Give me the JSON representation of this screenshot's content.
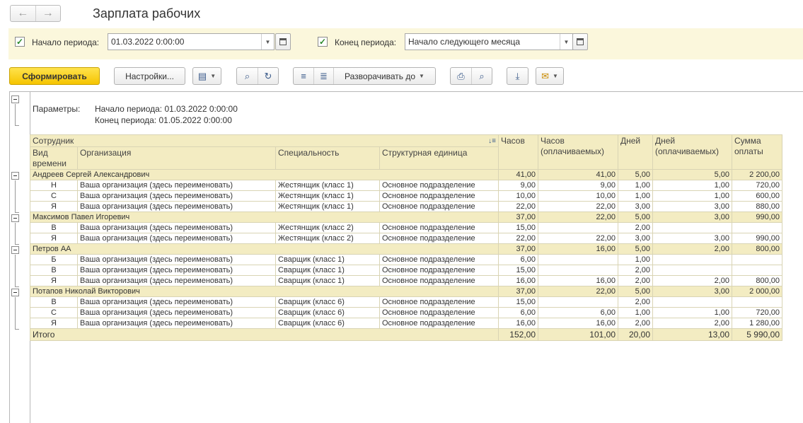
{
  "window": {
    "title": "Зарплата рабочих"
  },
  "nav": {
    "back": "←",
    "forward": "→"
  },
  "period": {
    "start_label": "Начало периода:",
    "start_value": "01.03.2022  0:00:00",
    "end_label": "Конец периода:",
    "end_value": "Начало следующего месяца",
    "start_checked": "✓",
    "end_checked": "✓"
  },
  "toolbar": {
    "generate": "Сформировать",
    "settings": "Настройки...",
    "expand": "Разворачивать до"
  },
  "params": {
    "label": "Параметры:",
    "line1": "Начало периода: 01.03.2022 0:00:00",
    "line2": "Конец периода: 01.05.2022 0:00:00"
  },
  "columns": {
    "employee": "Сотрудник",
    "time_type": "Вид времени",
    "org": "Организация",
    "spec": "Специальность",
    "unit": "Структурная единица",
    "hours": "Часов",
    "hours_paid": "Часов (оплачиваемых)",
    "days": "Дней",
    "days_paid": "Дней (оплачиваемых)",
    "sum": "Сумма оплаты"
  },
  "groups": [
    {
      "name": "Андреев Сергей Александрович",
      "hours": "41,00",
      "hours_paid": "41,00",
      "days": "5,00",
      "days_paid": "5,00",
      "sum": "2 200,00",
      "rows": [
        {
          "type": "Н",
          "org": "Ваша организация (здесь переименовать)",
          "spec": "Жестянщик (класс 1)",
          "unit": "Основное подразделение",
          "hours": "9,00",
          "hours_paid": "9,00",
          "days": "1,00",
          "days_paid": "1,00",
          "sum": "720,00"
        },
        {
          "type": "С",
          "org": "Ваша организация (здесь переименовать)",
          "spec": "Жестянщик (класс 1)",
          "unit": "Основное подразделение",
          "hours": "10,00",
          "hours_paid": "10,00",
          "days": "1,00",
          "days_paid": "1,00",
          "sum": "600,00"
        },
        {
          "type": "Я",
          "org": "Ваша организация (здесь переименовать)",
          "spec": "Жестянщик (класс 1)",
          "unit": "Основное подразделение",
          "hours": "22,00",
          "hours_paid": "22,00",
          "days": "3,00",
          "days_paid": "3,00",
          "sum": "880,00"
        }
      ]
    },
    {
      "name": "Максимов Павел Игоревич",
      "hours": "37,00",
      "hours_paid": "22,00",
      "days": "5,00",
      "days_paid": "3,00",
      "sum": "990,00",
      "rows": [
        {
          "type": "В",
          "org": "Ваша организация (здесь переименовать)",
          "spec": "Жестянщик (класс 2)",
          "unit": "Основное подразделение",
          "hours": "15,00",
          "hours_paid": "",
          "days": "2,00",
          "days_paid": "",
          "sum": ""
        },
        {
          "type": "Я",
          "org": "Ваша организация (здесь переименовать)",
          "spec": "Жестянщик (класс 2)",
          "unit": "Основное подразделение",
          "hours": "22,00",
          "hours_paid": "22,00",
          "days": "3,00",
          "days_paid": "3,00",
          "sum": "990,00"
        }
      ]
    },
    {
      "name": "Петров АА",
      "hours": "37,00",
      "hours_paid": "16,00",
      "days": "5,00",
      "days_paid": "2,00",
      "sum": "800,00",
      "rows": [
        {
          "type": "Б",
          "org": "Ваша организация (здесь переименовать)",
          "spec": "Сварщик (класс 1)",
          "unit": "Основное подразделение",
          "hours": "6,00",
          "hours_paid": "",
          "days": "1,00",
          "days_paid": "",
          "sum": ""
        },
        {
          "type": "В",
          "org": "Ваша организация (здесь переименовать)",
          "spec": "Сварщик (класс 1)",
          "unit": "Основное подразделение",
          "hours": "15,00",
          "hours_paid": "",
          "days": "2,00",
          "days_paid": "",
          "sum": ""
        },
        {
          "type": "Я",
          "org": "Ваша организация (здесь переименовать)",
          "spec": "Сварщик (класс 1)",
          "unit": "Основное подразделение",
          "hours": "16,00",
          "hours_paid": "16,00",
          "days": "2,00",
          "days_paid": "2,00",
          "sum": "800,00"
        }
      ]
    },
    {
      "name": "Потапов Николай Викторович",
      "hours": "37,00",
      "hours_paid": "22,00",
      "days": "5,00",
      "days_paid": "3,00",
      "sum": "2 000,00",
      "rows": [
        {
          "type": "В",
          "org": "Ваша организация (здесь переименовать)",
          "spec": "Сварщик (класс 6)",
          "unit": "Основное подразделение",
          "hours": "15,00",
          "hours_paid": "",
          "days": "2,00",
          "days_paid": "",
          "sum": ""
        },
        {
          "type": "С",
          "org": "Ваша организация (здесь переименовать)",
          "spec": "Сварщик (класс 6)",
          "unit": "Основное подразделение",
          "hours": "6,00",
          "hours_paid": "6,00",
          "days": "1,00",
          "days_paid": "1,00",
          "sum": "720,00"
        },
        {
          "type": "Я",
          "org": "Ваша организация (здесь переименовать)",
          "spec": "Сварщик (класс 6)",
          "unit": "Основное подразделение",
          "hours": "16,00",
          "hours_paid": "16,00",
          "days": "2,00",
          "days_paid": "2,00",
          "sum": "1 280,00"
        }
      ]
    }
  ],
  "total": {
    "label": "Итого",
    "hours": "152,00",
    "hours_paid": "101,00",
    "days": "20,00",
    "days_paid": "13,00",
    "sum": "5 990,00"
  }
}
